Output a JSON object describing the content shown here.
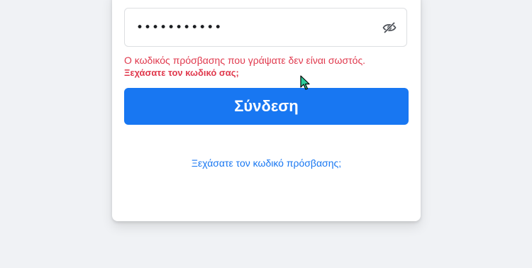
{
  "login": {
    "password_value": "•••••••••••",
    "error_message": "Ο κωδικός πρόσβασης που γράψατε δεν είναι σωστός.",
    "forgot_inline": "Ξεχάσατε τον κωδικό σας;",
    "submit_label": "Σύνδεση",
    "forgot_password_link": "Ξεχάσατε τον κωδικό πρόσβασης;"
  },
  "icons": {
    "password_toggle": "eye-slash-icon",
    "cursor": "mouse-pointer-icon"
  },
  "colors": {
    "background": "#f0f2f5",
    "primary": "#1877f2",
    "error": "#e0394d",
    "cursor": "#2ecc9a"
  }
}
